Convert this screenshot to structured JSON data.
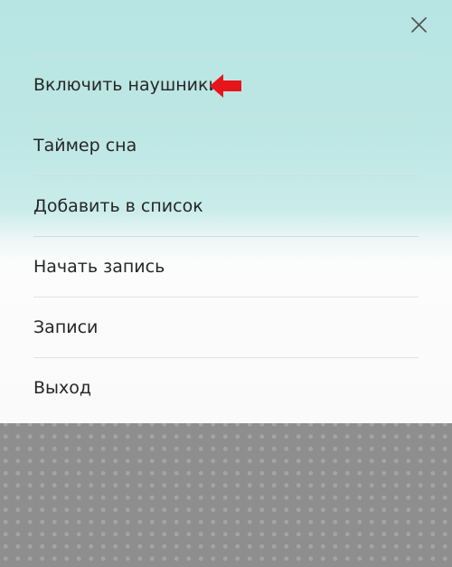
{
  "menu": {
    "items": [
      {
        "label": "Включить наушники"
      },
      {
        "label": "Таймер сна"
      },
      {
        "label": "Добавить в список"
      },
      {
        "label": "Начать запись"
      },
      {
        "label": "Записи"
      },
      {
        "label": "Выход"
      }
    ]
  },
  "icons": {
    "close": "close-icon",
    "annotation": "red-arrow-left-icon"
  },
  "colors": {
    "accent_arrow": "#e8141c",
    "sheet_top": "#b7e5e3",
    "sheet_bottom": "#fafafa",
    "dimmed_background": "#8e8e8e"
  }
}
